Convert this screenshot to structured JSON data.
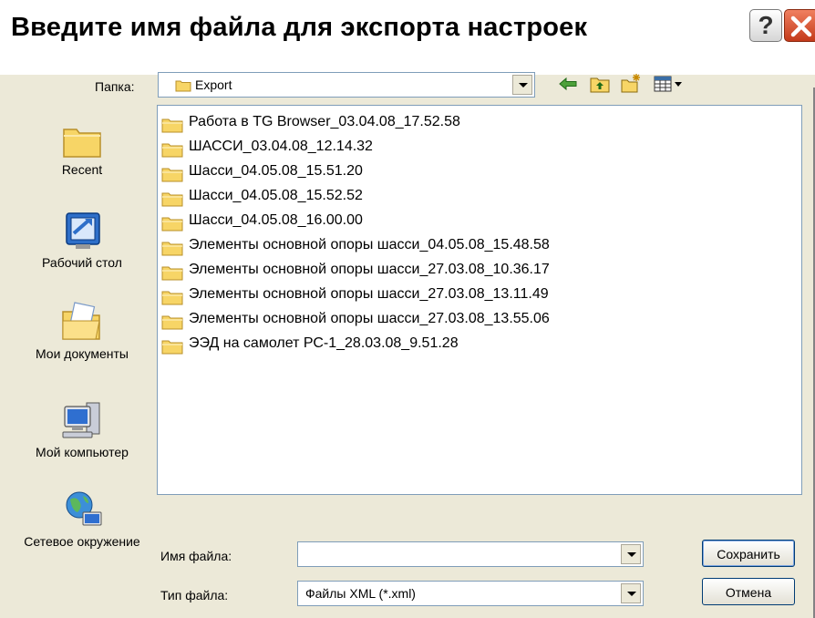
{
  "dialog": {
    "title": "Введите имя файла для экспорта настроек",
    "help_glyph": "?"
  },
  "toolbar": {
    "folder_label": "Папка:",
    "folder_value": "Export",
    "icons": [
      "back-arrow-icon",
      "up-folder-icon",
      "new-folder-icon",
      "view-menu-icon"
    ]
  },
  "places": [
    {
      "label": "Recent",
      "icon": "recent-folder-icon"
    },
    {
      "label": "Рабочий стол",
      "icon": "desktop-icon"
    },
    {
      "label": "Мои документы",
      "icon": "my-documents-icon"
    },
    {
      "label": "Мой компьютер",
      "icon": "my-computer-icon"
    },
    {
      "label": "Сетевое окружение",
      "icon": "network-icon"
    }
  ],
  "files": [
    "Работа в TG Browser_03.04.08_17.52.58",
    "ШАССИ_03.04.08_12.14.32",
    "Шасси_04.05.08_15.51.20",
    "Шасси_04.05.08_15.52.52",
    "Шасси_04.05.08_16.00.00",
    "Элементы основной опоры шасси_04.05.08_15.48.58",
    "Элементы основной опоры шасси_27.03.08_10.36.17",
    "Элементы основной опоры шасси_27.03.08_13.11.49",
    "Элементы основной опоры шасси_27.03.08_13.55.06",
    "ЭЭД на самолет РС-1_28.03.08_9.51.28"
  ],
  "form": {
    "filename_label": "Имя файла:",
    "filename_value": "",
    "filetype_label": "Тип файла:",
    "filetype_value": "Файлы XML (*.xml)"
  },
  "buttons": {
    "save": "Сохранить",
    "cancel": "Отмена"
  },
  "colors": {
    "dialog_bg": "#ece9d8",
    "folder_yellow": "#f7d566",
    "close_red": "#d4502c",
    "input_border": "#7f9db9"
  }
}
